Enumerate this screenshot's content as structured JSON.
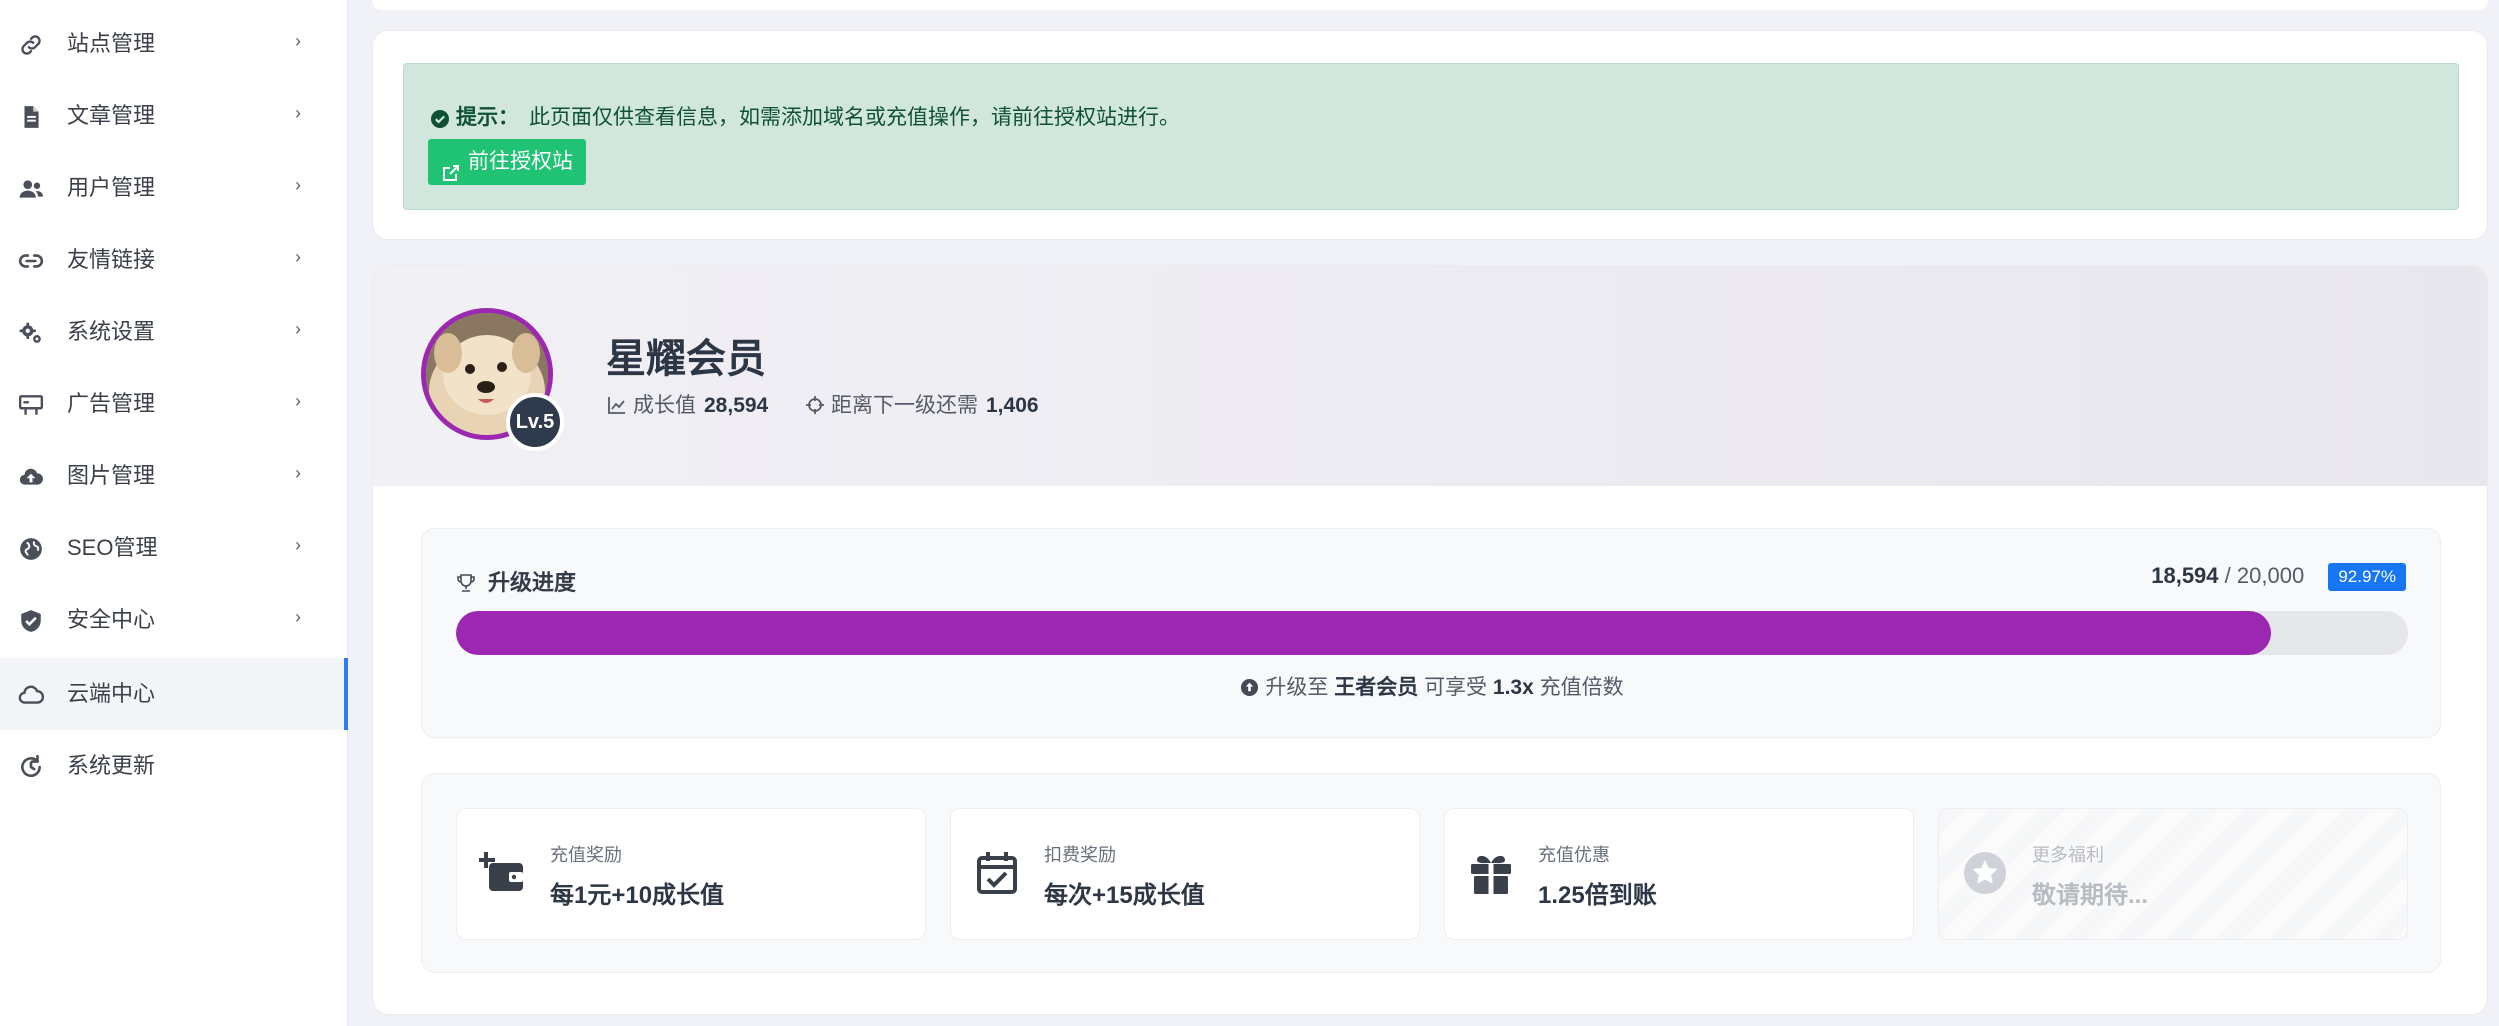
{
  "sidebar": {
    "items": [
      {
        "label": "站点管理",
        "icon": "link-icon",
        "has_arrow": true
      },
      {
        "label": "文章管理",
        "icon": "document-icon",
        "has_arrow": true
      },
      {
        "label": "用户管理",
        "icon": "users-icon",
        "has_arrow": true
      },
      {
        "label": "友情链接",
        "icon": "chain-icon",
        "has_arrow": true
      },
      {
        "label": "系统设置",
        "icon": "gears-icon",
        "has_arrow": true
      },
      {
        "label": "广告管理",
        "icon": "billboard-icon",
        "has_arrow": true
      },
      {
        "label": "图片管理",
        "icon": "cloud-upload-icon",
        "has_arrow": true
      },
      {
        "label": "SEO管理",
        "icon": "globe-icon",
        "has_arrow": true
      },
      {
        "label": "安全中心",
        "icon": "shield-check-icon",
        "has_arrow": true
      },
      {
        "label": "云端中心",
        "icon": "cloud-icon",
        "has_arrow": false,
        "active": true
      },
      {
        "label": "系统更新",
        "icon": "refresh-icon",
        "has_arrow": false
      }
    ],
    "arrow_glyph": "›"
  },
  "notice": {
    "title": "提示：",
    "text": "此页面仅供查看信息，如需添加域名或充值操作，请前往授权站进行。",
    "button_label": "前往授权站",
    "icon": "check-circle-icon",
    "button_icon": "external-link-icon"
  },
  "member": {
    "title": "星耀会员",
    "level": "Lv.5",
    "growth_label": "成长值",
    "growth_value": "28,594",
    "next_label": "距离下一级还需",
    "next_value": "1,406"
  },
  "progress": {
    "title": "升级进度",
    "current": "18,594",
    "separator": "/",
    "target": "20,000",
    "percent_label": "92.97%",
    "percent": 92.97,
    "note_prefix": "升级至",
    "next_level": "王者会员",
    "note_mid": "可享受",
    "multiplier": "1.3x",
    "note_suffix": "充值倍数"
  },
  "benefits": [
    {
      "label": "充值奖励",
      "value": "每1元+10成长值",
      "icon": "wallet-plus-icon",
      "disabled": false
    },
    {
      "label": "扣费奖励",
      "value": "每次+15成长值",
      "icon": "calendar-check-icon",
      "disabled": false
    },
    {
      "label": "充值优惠",
      "value": "1.25倍到账",
      "icon": "gift-icon",
      "disabled": false
    },
    {
      "label": "更多福利",
      "value": "敬请期待...",
      "icon": "star-icon",
      "disabled": true
    }
  ],
  "colors": {
    "accent": "#9c27b0",
    "active_indicator": "#2a7df6",
    "success_bg": "#d1e7dd",
    "success_button": "#20c374",
    "badge_blue": "#1676f3"
  }
}
